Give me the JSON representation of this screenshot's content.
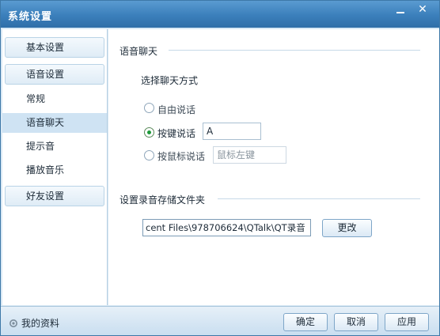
{
  "window": {
    "title": "系统设置"
  },
  "title_buttons": {
    "minimize": "–",
    "close": "✕"
  },
  "sidebar": {
    "groups": [
      {
        "label": "基本设置"
      },
      {
        "label": "语音设置"
      },
      {
        "label": "好友设置"
      }
    ],
    "items": [
      {
        "label": "常规"
      },
      {
        "label": "语音聊天",
        "active": true
      },
      {
        "label": "提示音"
      },
      {
        "label": "播放音乐"
      }
    ]
  },
  "main": {
    "section_voice_chat": "语音聊天",
    "choose_mode_label": "选择聊天方式",
    "options": [
      {
        "label": "自由说话",
        "checked": false
      },
      {
        "label": "按键说话",
        "checked": true,
        "value": "A"
      },
      {
        "label": "按鼠标说话",
        "checked": false,
        "value": "鼠标左键"
      }
    ],
    "section_record_folder": "设置录音存储文件夹",
    "record_path": "cent Files\\978706624\\QTalk\\QT录音",
    "change_button": "更改"
  },
  "footer": {
    "profile_label": "我的资料",
    "ok_button": "确定",
    "cancel_button": "取消",
    "apply_button": "应用"
  },
  "colors": {
    "titlebar": "#3b7fbb",
    "active_item": "#cfe3f3",
    "radio_checked": "#1e9a3a"
  }
}
